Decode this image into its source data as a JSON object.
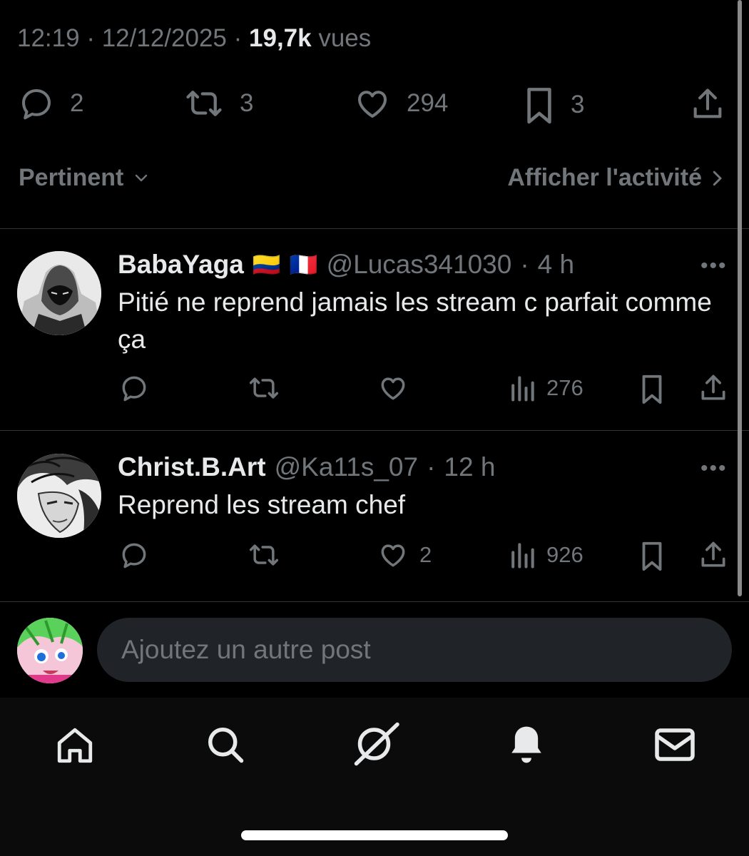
{
  "post_meta": {
    "time": "12:19",
    "date": "12/12/2025",
    "views_count": "19,7k",
    "views_label": "vues",
    "separator": "·"
  },
  "stats": {
    "replies": "2",
    "reposts": "3",
    "likes": "294",
    "bookmarks": "3"
  },
  "sort": {
    "label": "Pertinent",
    "activity_label": "Afficher l'activité"
  },
  "replies": [
    {
      "display_name": "BabaYaga",
      "flags": [
        "🇨🇴",
        "🇫🇷"
      ],
      "handle": "@Lucas341030",
      "time": "4 h",
      "text": "Pitié ne reprend jamais les stream c parfait comme ça",
      "likes": "",
      "views": "276"
    },
    {
      "display_name": "Christ.B.Art",
      "flags": [],
      "handle": "@Ka11s_07",
      "time": "12 h",
      "text": "Reprend les stream chef",
      "likes": "2",
      "views": "926"
    }
  ],
  "composer": {
    "placeholder": "Ajoutez un autre post"
  },
  "nav": [
    "home-icon",
    "search-icon",
    "grok-icon",
    "notifications-icon",
    "messages-icon"
  ],
  "colors": {
    "background": "#000000",
    "text": "#e7e9ea",
    "muted": "#71767b",
    "divider": "#2f3336",
    "composer_bg": "#202327"
  }
}
